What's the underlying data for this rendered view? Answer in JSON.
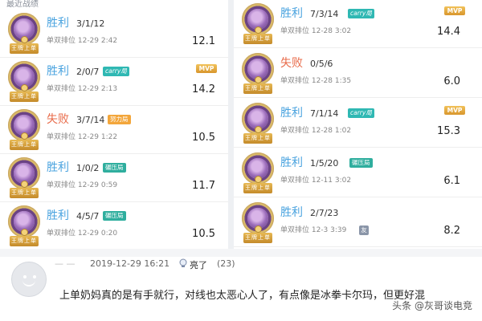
{
  "section_title": "最近战绩",
  "avatar_badge": "王牌上单",
  "left_matches": [
    {
      "result": "胜利",
      "kda": "3/1/12",
      "tag": "",
      "meta": "单双排位  12-29  2:42",
      "mvp": "",
      "score": "12.1"
    },
    {
      "result": "胜利",
      "kda": "2/0/7",
      "tag": "carry局",
      "meta": "单双排位  12-29  2:13",
      "mvp": "MVP",
      "score": "14.2"
    },
    {
      "result": "失败",
      "kda": "3/7/14",
      "tag": "努力局",
      "meta": "单双排位  12-29  1:22",
      "mvp": "",
      "score": "10.5"
    },
    {
      "result": "胜利",
      "kda": "1/0/2",
      "tag": "碾压局",
      "meta": "单双排位  12-29  0:59",
      "mvp": "",
      "score": "11.7"
    },
    {
      "result": "胜利",
      "kda": "4/5/7",
      "tag": "碾压局",
      "meta": "单双排位  12-29  0:20",
      "mvp": "",
      "score": "10.5"
    }
  ],
  "right_matches": [
    {
      "result": "胜利",
      "kda": "7/3/14",
      "tag": "carry局",
      "meta": "单双排位  12-28  3:02",
      "mvp": "MVP",
      "score": "14.4"
    },
    {
      "result": "失败",
      "kda": "0/5/6",
      "tag": "",
      "meta": "单双排位  12-28  1:35",
      "mvp": "",
      "score": "6.0"
    },
    {
      "result": "胜利",
      "kda": "7/1/14",
      "tag": "carry局",
      "meta": "单双排位  12-28  1:02",
      "mvp": "MVP",
      "score": "15.3"
    },
    {
      "result": "胜利",
      "kda": "1/5/20",
      "tag": "碾压局",
      "meta": "单双排位  12-11  3:02",
      "mvp": "",
      "score": "6.1"
    },
    {
      "result": "胜利",
      "kda": "2/7/23",
      "tag": "",
      "meta": "单双排位  12-3  3:39",
      "extra_tag": "友",
      "mvp": "",
      "score": "8.2"
    }
  ],
  "comment": {
    "username": "—  —",
    "time": "2019-12-29 16:21",
    "like_label": "亮了",
    "like_count": "(23)",
    "text": "上单奶妈真的是有手就行，对线也太恶心人了，有点像是冰拳卡尔玛，但更好混",
    "watermark": "头条 @灰哥谈电竞"
  },
  "colors": {
    "win": "#4aa3df",
    "loss": "#e86b4a",
    "carry_tag": "#2fb8b3",
    "effort_tag": "#f3a63b",
    "crush_tag": "#2fae9e",
    "mvp": "#e0a83a"
  },
  "icons": {
    "avatar": "hero-portrait-icon",
    "like": "lightbulb-like-icon",
    "commenter": "smiley-avatar-icon"
  }
}
